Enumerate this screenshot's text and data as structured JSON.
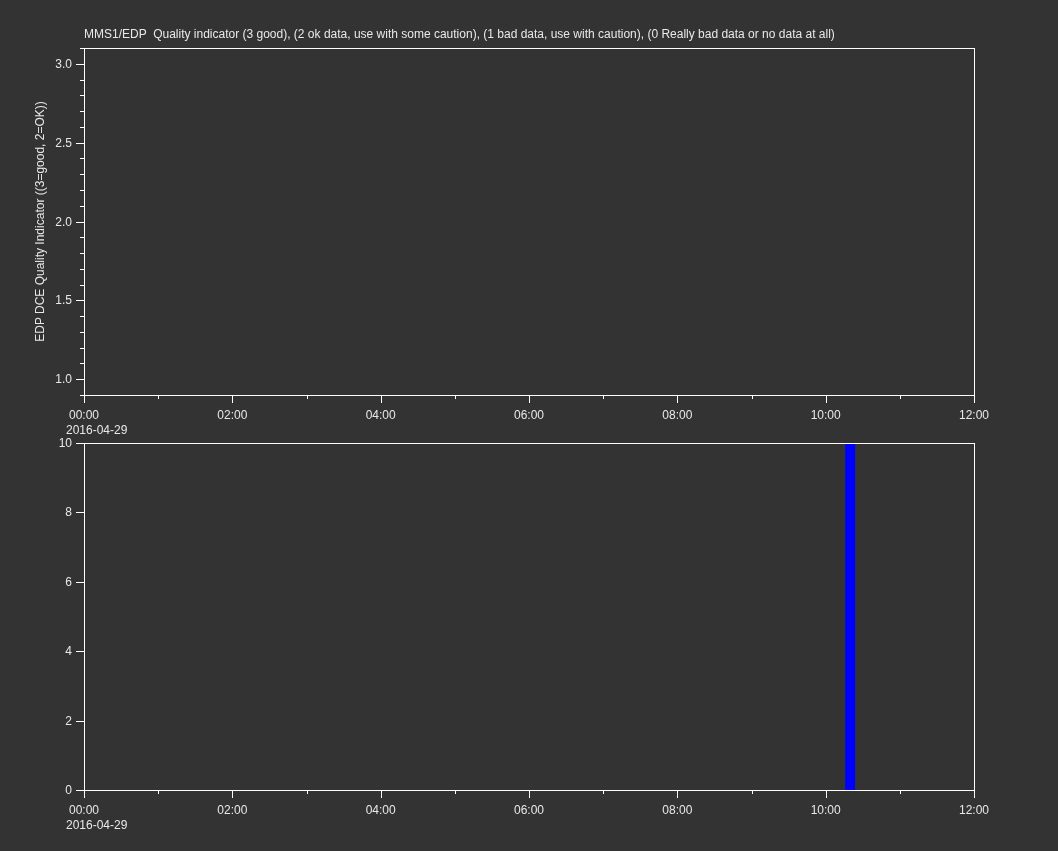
{
  "plots": [
    {
      "date_label": "2016-04-29",
      "chart_data": {
        "type": "scatter",
        "title": "MMS1/EDP  Quality indicator (3 good), (2 ok data, use with some caution), (1 bad data, use with caution), (0 Really bad data or no data at all)",
        "ylabel": "EDP DCE Quality Indicator ((3=good, 2=OK))",
        "xlim": [
          0,
          12
        ],
        "ylim": [
          0.9,
          3.1
        ],
        "xticks": [
          {
            "value": 0,
            "label": "00:00"
          },
          {
            "value": 2,
            "label": "02:00"
          },
          {
            "value": 4,
            "label": "04:00"
          },
          {
            "value": 6,
            "label": "06:00"
          },
          {
            "value": 8,
            "label": "08:00"
          },
          {
            "value": 10,
            "label": "10:00"
          },
          {
            "value": 12,
            "label": "12:00"
          }
        ],
        "yticks": [
          {
            "value": 1,
            "label": "1.0"
          },
          {
            "value": 1.5,
            "label": "1.5"
          },
          {
            "value": 2,
            "label": "2.0"
          },
          {
            "value": 2.5,
            "label": "2.5"
          },
          {
            "value": 3,
            "label": "3.0"
          }
        ]
      }
    },
    {
      "date_label": "2016-04-29",
      "chart_data": {
        "type": "bar",
        "x": [
          10.33
        ],
        "series": [
          {
            "color": "#0000ff",
            "values": [
              10
            ]
          }
        ],
        "xlim": [
          0,
          12
        ],
        "ylim": [
          0,
          10
        ],
        "xticks": [
          {
            "value": 0,
            "label": "00:00"
          },
          {
            "value": 2,
            "label": "02:00"
          },
          {
            "value": 4,
            "label": "04:00"
          },
          {
            "value": 6,
            "label": "06:00"
          },
          {
            "value": 8,
            "label": "08:00"
          },
          {
            "value": 10,
            "label": "10:00"
          },
          {
            "value": 12,
            "label": "12:00"
          }
        ],
        "yticks": [
          0,
          2,
          4,
          6,
          8,
          10
        ]
      }
    }
  ]
}
